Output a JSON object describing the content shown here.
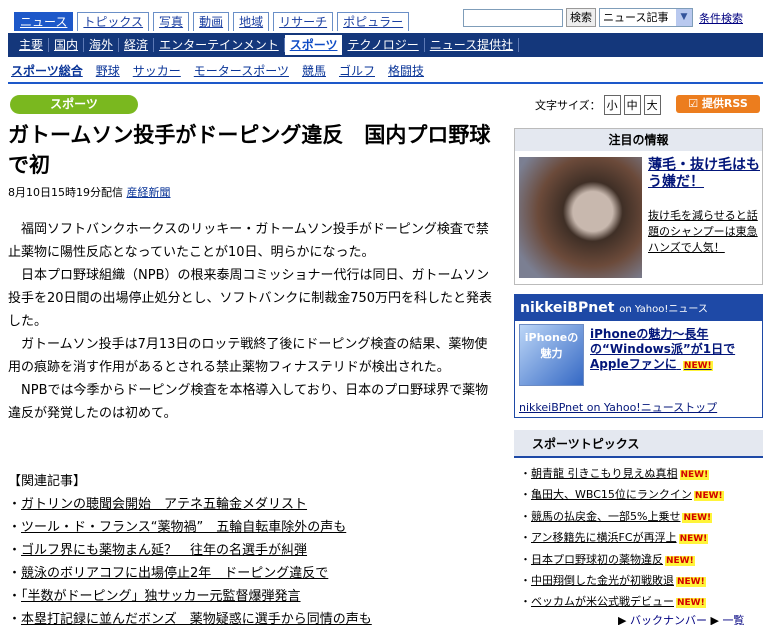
{
  "top_tabs": [
    "ニュース",
    "トピックス",
    "写真",
    "動画",
    "地域",
    "リサーチ",
    "ポピュラー"
  ],
  "search": {
    "button": "検索",
    "select": "ニュース記事",
    "advanced": "条件検索"
  },
  "category_nav": [
    "主要",
    "国内",
    "海外",
    "経済",
    "エンターテインメント",
    "スポーツ",
    "テクノロジー",
    "ニュース提供社"
  ],
  "sports_nav": [
    "スポーツ総合",
    "野球",
    "サッカー",
    "モータースポーツ",
    "競馬",
    "ゴルフ",
    "格闘技"
  ],
  "section_badge": "スポーツ",
  "font_size": {
    "label": "文字サイズ：",
    "small": "小",
    "medium": "中",
    "large": "大"
  },
  "rss": "提供RSS",
  "article": {
    "headline": "ガトームソン投手がドーピング違反　国内プロ野球で初",
    "date": "8月10日15時19分配信",
    "source": "産経新聞",
    "paragraphs": [
      "福岡ソフトバンクホークスのリッキー・ガトームソン投手がドーピング検査で禁止薬物に陽性反応となっていたことが10日、明らかになった。",
      "日本プロ野球組織（NPB）の根来泰周コミッショナー代行は同日、ガトームソン投手を20日間の出場停止処分とし、ソフトバンクに制裁金750万円を科したと発表した。",
      "ガトームソン投手は7月13日のロッテ戦終了後にドーピング検査の結果、薬物使用の痕跡を消す作用があるとされる禁止薬物フィナステリドが検出された。",
      "NPBでは今季からドーピング検査を本格導入しており、日本のプロ野球界で薬物違反が発覚したのは初めて。"
    ],
    "related_title": "【関連記事】",
    "related": [
      "ガトリンの聴聞会開始　アテネ五輪金メダリスト",
      "ツール・ド・フランス“薬物禍”　五輪自転車除外の声も",
      "ゴルフ界にも薬物まん延？　往年の名選手が糾弾",
      "競泳のボリアコフに出場停止2年　ドーピング違反で",
      "「半数がドーピング」独サッカー元監督爆弾発言",
      "本塁打記録に並んだボンズ　薬物疑惑に選手から同情の声も"
    ]
  },
  "notice": {
    "header": "注目の情報",
    "title": "薄毛・抜け毛はもう嫌だ！",
    "text": "抜け毛を減らせると話題のシャンプーは東急ハンズで人気！"
  },
  "nbp": {
    "header": "nikkeiBPnet",
    "header_sub": "on Yahoo!ニュース",
    "icon_label": "iPhoneの魅力",
    "text": "iPhoneの魅力～長年の“Windows派”が1日でAppleファンに",
    "new": "NEW!",
    "link": "nikkeiBPnet on Yahoo!ニューストップ"
  },
  "topics": {
    "header": "スポーツトピックス",
    "items": [
      "朝青龍 引きこもり見えぬ真相",
      "亀田大、WBC15位にランクイン",
      "競馬の払戻金、一部5%上乗せ",
      "アン移籍先に横浜FCが再浮上",
      "日本プロ野球初の薬物違反",
      "中田翔倒した金光が初戦敗退",
      "ベッカムが米公式戦デビュー"
    ],
    "new": "NEW!"
  },
  "back_number": {
    "label": "バックナンバー",
    "all": "一覧"
  }
}
